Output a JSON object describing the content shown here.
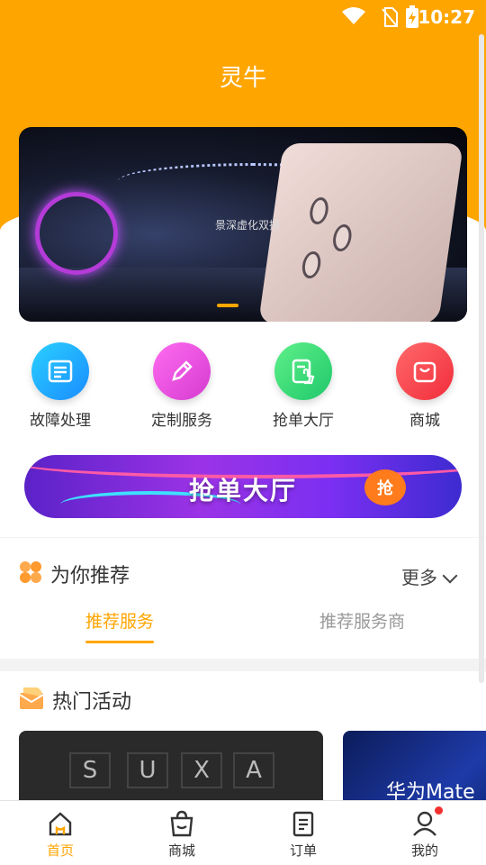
{
  "status_bar": {
    "time": "10:27"
  },
  "header": {
    "title": "灵牛"
  },
  "banner": {
    "caption": "景深虚化双摄"
  },
  "quick_actions": [
    {
      "label": "故障处理",
      "icon": "ticket-list-icon",
      "color": "#1aa4ff"
    },
    {
      "label": "定制服务",
      "icon": "pencil-ruler-icon",
      "color": "#f14bd6"
    },
    {
      "label": "抢单大厅",
      "icon": "hand-tap-doc-icon",
      "color": "#2fd674"
    },
    {
      "label": "商城",
      "icon": "shopping-bag-icon",
      "color": "#f5333f"
    }
  ],
  "grab_banner": {
    "text": "抢单大厅",
    "badge": "抢"
  },
  "recommend": {
    "title": "为你推荐",
    "more": "更多",
    "tabs": [
      {
        "label": "推荐服务",
        "active": true
      },
      {
        "label": "推荐服务商",
        "active": false
      }
    ]
  },
  "hot": {
    "title": "热门活动",
    "cards": [
      {
        "letters": [
          "S",
          "U",
          "X",
          "A"
        ]
      },
      {
        "text": "华为Mate"
      }
    ]
  },
  "bottom_nav": [
    {
      "label": "首页",
      "icon": "home-icon",
      "active": true
    },
    {
      "label": "商城",
      "icon": "shop-bag-icon",
      "active": false
    },
    {
      "label": "订单",
      "icon": "order-icon",
      "active": false
    },
    {
      "label": "我的",
      "icon": "profile-icon",
      "active": false
    }
  ],
  "colors": {
    "accent": "#ffa500"
  }
}
